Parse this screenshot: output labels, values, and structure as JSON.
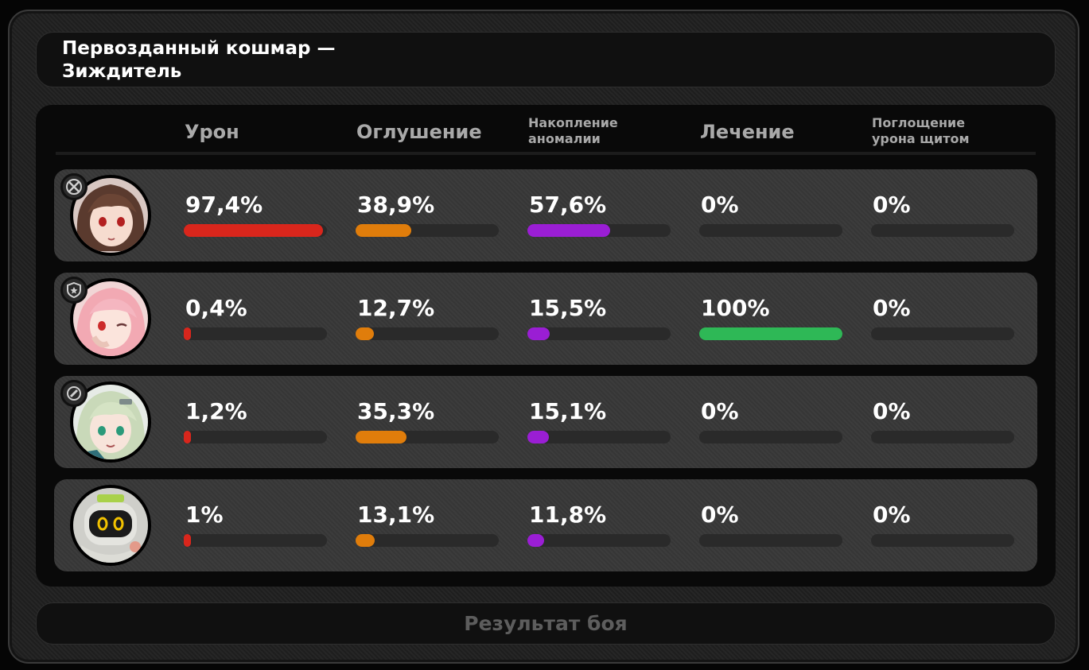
{
  "title": "Первозданный кошмар — Зиждитель",
  "columns": {
    "damage": "Урон",
    "daze": "Оглушение",
    "anomaly_line1": "Накопление",
    "anomaly_line2": "аномалии",
    "healing": "Лечение",
    "shield_line1": "Поглощение",
    "shield_line2": "урона щитом"
  },
  "colors": {
    "damage": "#d9261c",
    "daze": "#e07d0b",
    "anomaly": "#9a1ed4",
    "healing": "#2eb856",
    "track": "#2a2a2a"
  },
  "rows": [
    {
      "role_icon": "attack-role-icon",
      "avatar": "brown-haired-agent-avatar",
      "damage": "97,4%",
      "daze": "38,9%",
      "anomaly": "57,6%",
      "healing": "0%",
      "shield": "0%",
      "damage_pct": 97.4,
      "daze_pct": 38.9,
      "anomaly_pct": 57.6,
      "healing_pct": 0,
      "shield_pct": 0
    },
    {
      "role_icon": "defense-role-icon",
      "avatar": "pink-haired-agent-avatar",
      "damage": "0,4%",
      "daze": "12,7%",
      "anomaly": "15,5%",
      "healing": "100%",
      "shield": "0%",
      "damage_pct": 0.4,
      "daze_pct": 12.7,
      "anomaly_pct": 15.5,
      "healing_pct": 100,
      "shield_pct": 0
    },
    {
      "role_icon": "support-role-icon",
      "avatar": "green-haired-agent-avatar",
      "damage": "1,2%",
      "daze": "35,3%",
      "anomaly": "15,1%",
      "healing": "0%",
      "shield": "0%",
      "damage_pct": 1.2,
      "daze_pct": 35.3,
      "anomaly_pct": 15.1,
      "healing_pct": 0,
      "shield_pct": 0
    },
    {
      "role_icon": "",
      "avatar": "bangboo-robot-avatar",
      "damage": "1%",
      "daze": "13,1%",
      "anomaly": "11,8%",
      "healing": "0%",
      "shield": "0%",
      "damage_pct": 1,
      "daze_pct": 13.1,
      "anomaly_pct": 11.8,
      "healing_pct": 0,
      "shield_pct": 0
    }
  ],
  "footer": "Результат боя"
}
